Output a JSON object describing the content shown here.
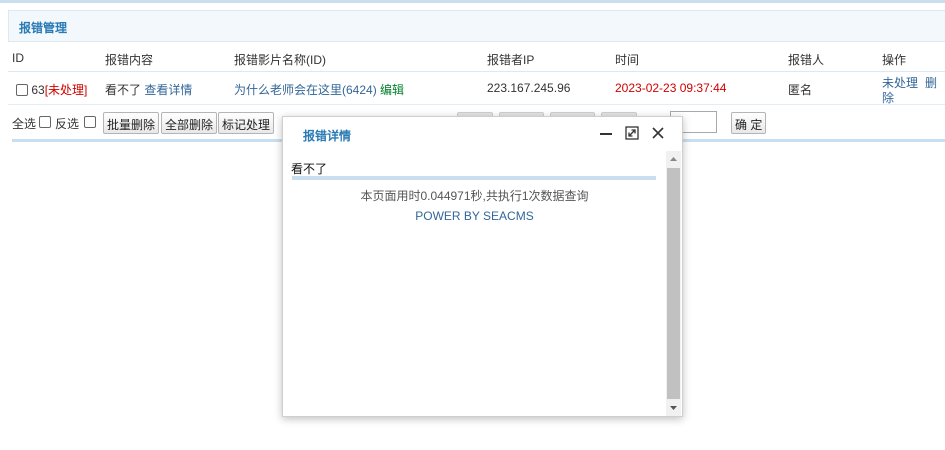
{
  "panel": {
    "title": "报错管理"
  },
  "table": {
    "headers": [
      "ID",
      "报错内容",
      "报错影片名称(ID)",
      "报错者IP",
      "时间",
      "报错人",
      "操作"
    ],
    "rows": [
      {
        "id": "63",
        "status": "[未处理]",
        "content": "看不了",
        "detail_link": "查看详情",
        "movie": "为什么老师会在这里(6424)",
        "edit": "编辑",
        "ip": "223.167.245.96",
        "time": "2023-02-23 09:37:44",
        "reporter": "匿名",
        "action_process": "未处理",
        "action_delete_1": "删",
        "action_delete_2": "除"
      }
    ]
  },
  "actions": {
    "select_all": "全选",
    "invert": "反选",
    "batch_delete": "批量删除",
    "delete_all": "全部删除",
    "mark_processed": "标记处理",
    "confirm": "确 定"
  },
  "dialog": {
    "title": "报错详情",
    "content": "看不了",
    "footer_line": "本页面用时0.044971秒,共执行1次数据查询",
    "power": "POWER BY SEACMS"
  },
  "colors": {
    "accent": "#2a7ab5",
    "status_red": "#d00000",
    "link_blue": "#336699",
    "edit_green": "#00802b"
  }
}
